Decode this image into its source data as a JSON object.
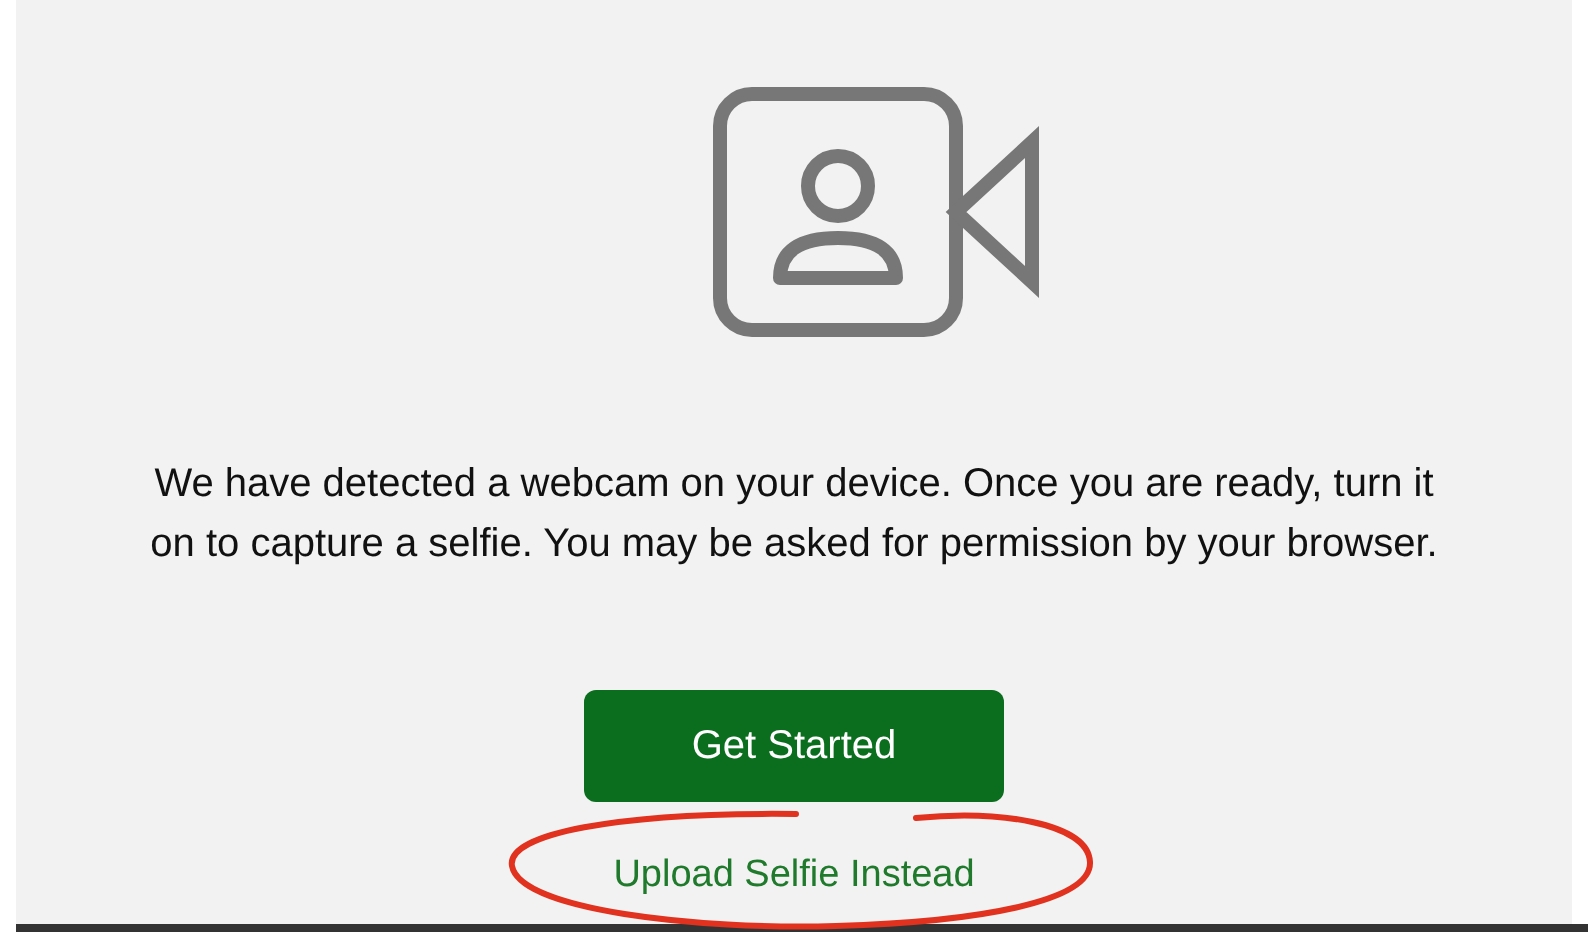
{
  "message": "We have detected a webcam on your device. Once you are ready, turn it on to capture a selfie. You may be asked for permission by your browser.",
  "primary_button": "Get Started",
  "secondary_link": "Upload Selfie Instead"
}
